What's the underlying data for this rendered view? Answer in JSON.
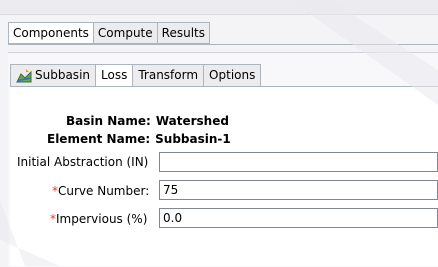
{
  "outer_tabs": [
    {
      "label": "Components",
      "active": true
    },
    {
      "label": "Compute",
      "active": false
    },
    {
      "label": "Results",
      "active": false
    }
  ],
  "inner_tabs": [
    {
      "label": "Subbasin",
      "icon": "subbasin-icon",
      "active": false
    },
    {
      "label": "Loss",
      "active": true
    },
    {
      "label": "Transform",
      "active": false
    },
    {
      "label": "Options",
      "active": false
    }
  ],
  "info": {
    "basin_label": "Basin Name:",
    "basin_value": "Watershed",
    "element_label": "Element Name:",
    "element_value": "Subbasin-1"
  },
  "fields": {
    "initial_abstraction": {
      "label": "Initial Abstraction (IN)",
      "value": ""
    },
    "curve_number": {
      "required_mark": "*",
      "label": "Curve Number:",
      "value": "75"
    },
    "impervious": {
      "required_mark": "*",
      "label": "Impervious (%)",
      "value": "0.0"
    }
  },
  "colors": {
    "required": "#e0441a",
    "tab_border": "#aeb4bc",
    "active_tab": "#ffffff"
  }
}
